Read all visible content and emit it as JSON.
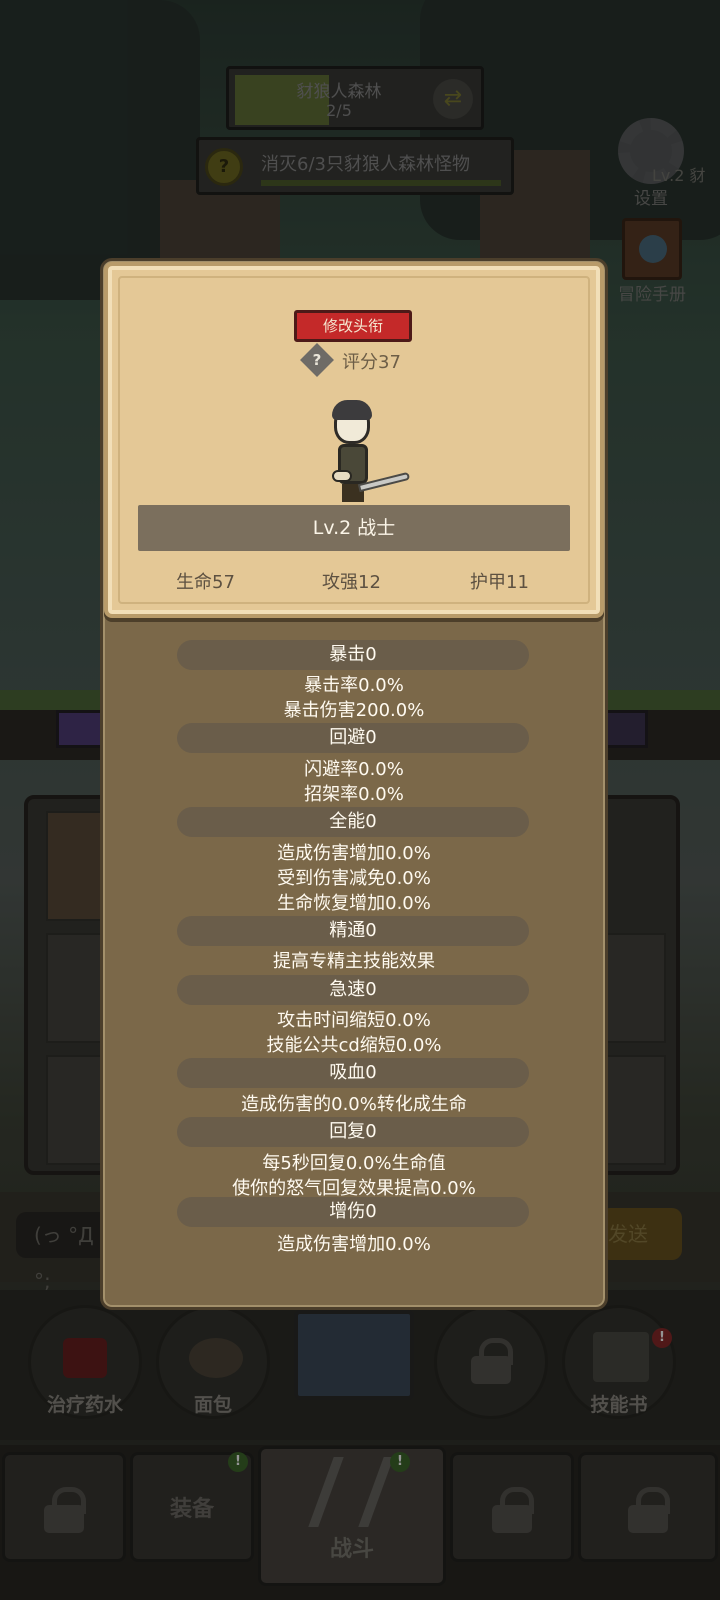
{
  "stage": {
    "name": "豺狼人森林",
    "progress": "2/5"
  },
  "quest": {
    "text": "消灭6/3只豺狼人森林怪物"
  },
  "side_buttons": {
    "settings": "设置",
    "level_tag": "Lv.2 豺",
    "handbook": "冒险手册"
  },
  "chat": {
    "input_value": "(っ °Д °;",
    "send_label": "发送"
  },
  "items": [
    {
      "label": "治疗药水"
    },
    {
      "label": "面包"
    },
    {
      "label": ""
    },
    {
      "label": ""
    },
    {
      "label": "技能书",
      "badge": "!"
    }
  ],
  "tabs": [
    {
      "label": ""
    },
    {
      "label": "装备",
      "badge": "!"
    },
    {
      "label": "战斗",
      "badge": "!"
    },
    {
      "label": ""
    },
    {
      "label": ""
    }
  ],
  "character": {
    "edit_title_button": "修改头衔",
    "help_icon": "?",
    "score": "评分37",
    "class_label": "Lv.2 战士",
    "top_stats": {
      "hp": "生命57",
      "atk": "攻强12",
      "armor": "护甲11"
    }
  },
  "attributes": [
    {
      "name": "暴击0",
      "lines": [
        "暴击率0.0%",
        "暴击伤害200.0%"
      ]
    },
    {
      "name": "回避0",
      "lines": [
        "闪避率0.0%",
        "招架率0.0%"
      ]
    },
    {
      "name": "全能0",
      "lines": [
        "造成伤害增加0.0%",
        "受到伤害减免0.0%",
        "生命恢复增加0.0%"
      ]
    },
    {
      "name": "精通0",
      "lines": [
        "提高专精主技能效果"
      ]
    },
    {
      "name": "急速0",
      "lines": [
        "攻击时间缩短0.0%",
        "技能公共cd缩短0.0%"
      ]
    },
    {
      "name": "吸血0",
      "lines": [
        "造成伤害的0.0%转化成生命"
      ]
    },
    {
      "name": "回复0",
      "lines": [
        "每5秒回复0.0%生命值",
        "使你的怒气回复效果提高0.0%"
      ]
    },
    {
      "name": "增伤0",
      "lines": [
        "造成伤害增加0.0%"
      ]
    }
  ],
  "colors": {
    "title_button": "#c42929",
    "card": "#e4c896",
    "panel": "#7b6849",
    "attr_pill": "#6a5d4a"
  }
}
